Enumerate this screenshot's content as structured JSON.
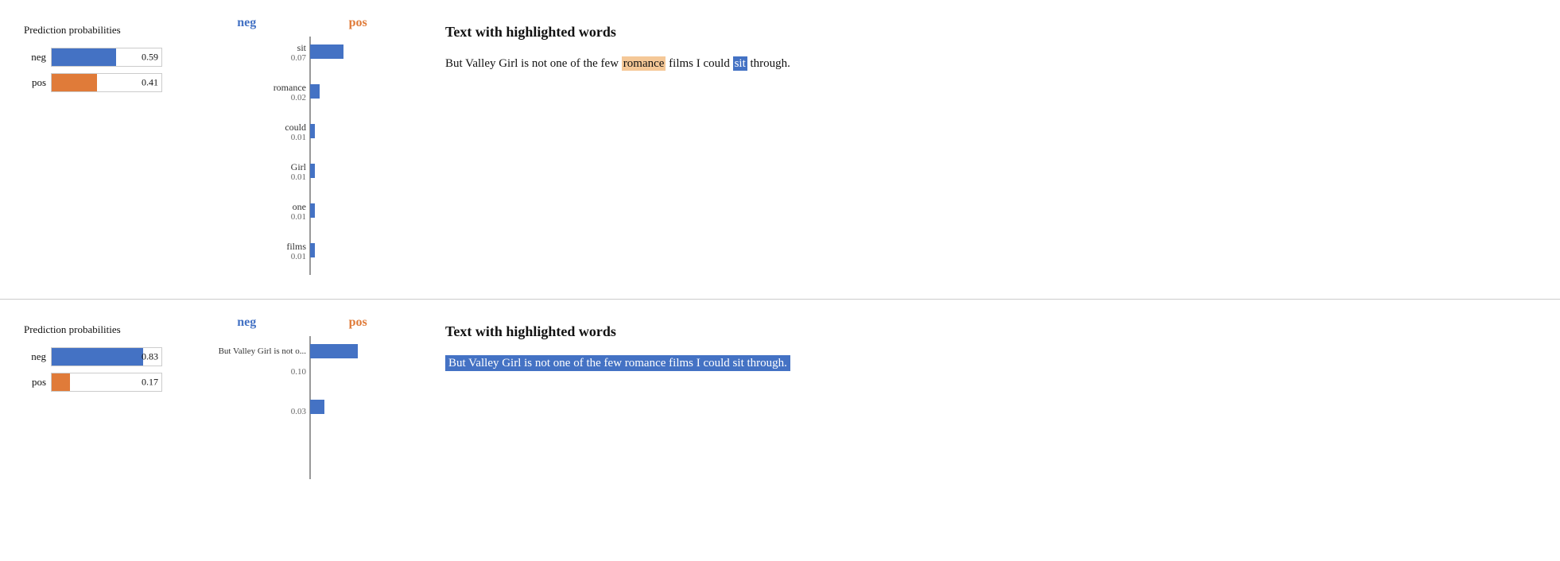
{
  "panel1": {
    "probs_title": "Prediction probabilities",
    "bars": [
      {
        "label": "neg",
        "value": 0.59,
        "color": "#4472c4",
        "display": "0.59"
      },
      {
        "label": "pos",
        "value": 0.41,
        "color": "#e07b39",
        "display": "0.41"
      }
    ],
    "chart": {
      "neg_label": "neg",
      "pos_label": "pos",
      "words": [
        {
          "word": "sit",
          "value": 0.07
        },
        {
          "word": "romance",
          "value": 0.02
        },
        {
          "word": "could",
          "value": 0.01
        },
        {
          "word": "Girl",
          "value": 0.01
        },
        {
          "word": "one",
          "value": 0.01
        },
        {
          "word": "films",
          "value": 0.01
        }
      ]
    },
    "text_title": "Text with highlighted words",
    "text_parts": [
      {
        "text": "But Valley Girl is not one of the few ",
        "type": "normal"
      },
      {
        "text": "romance",
        "type": "highlight-orange"
      },
      {
        "text": " films I could ",
        "type": "normal"
      },
      {
        "text": "sit",
        "type": "highlight-blue"
      },
      {
        "text": " through.",
        "type": "normal"
      }
    ]
  },
  "panel2": {
    "probs_title": "Prediction probabilities",
    "bars": [
      {
        "label": "neg",
        "value": 0.83,
        "color": "#4472c4",
        "display": "0.83"
      },
      {
        "label": "pos",
        "value": 0.17,
        "color": "#e07b39",
        "display": "0.17"
      }
    ],
    "chart": {
      "neg_label": "neg",
      "pos_label": "pos",
      "main_label": "But Valley Girl is not o...",
      "values": [
        {
          "label": "top",
          "neg_val": 0.1,
          "pos_val": 0.03
        }
      ]
    },
    "text_title": "Text with highlighted words",
    "text": "But Valley Girl is not one of the few romance films I could sit through."
  }
}
